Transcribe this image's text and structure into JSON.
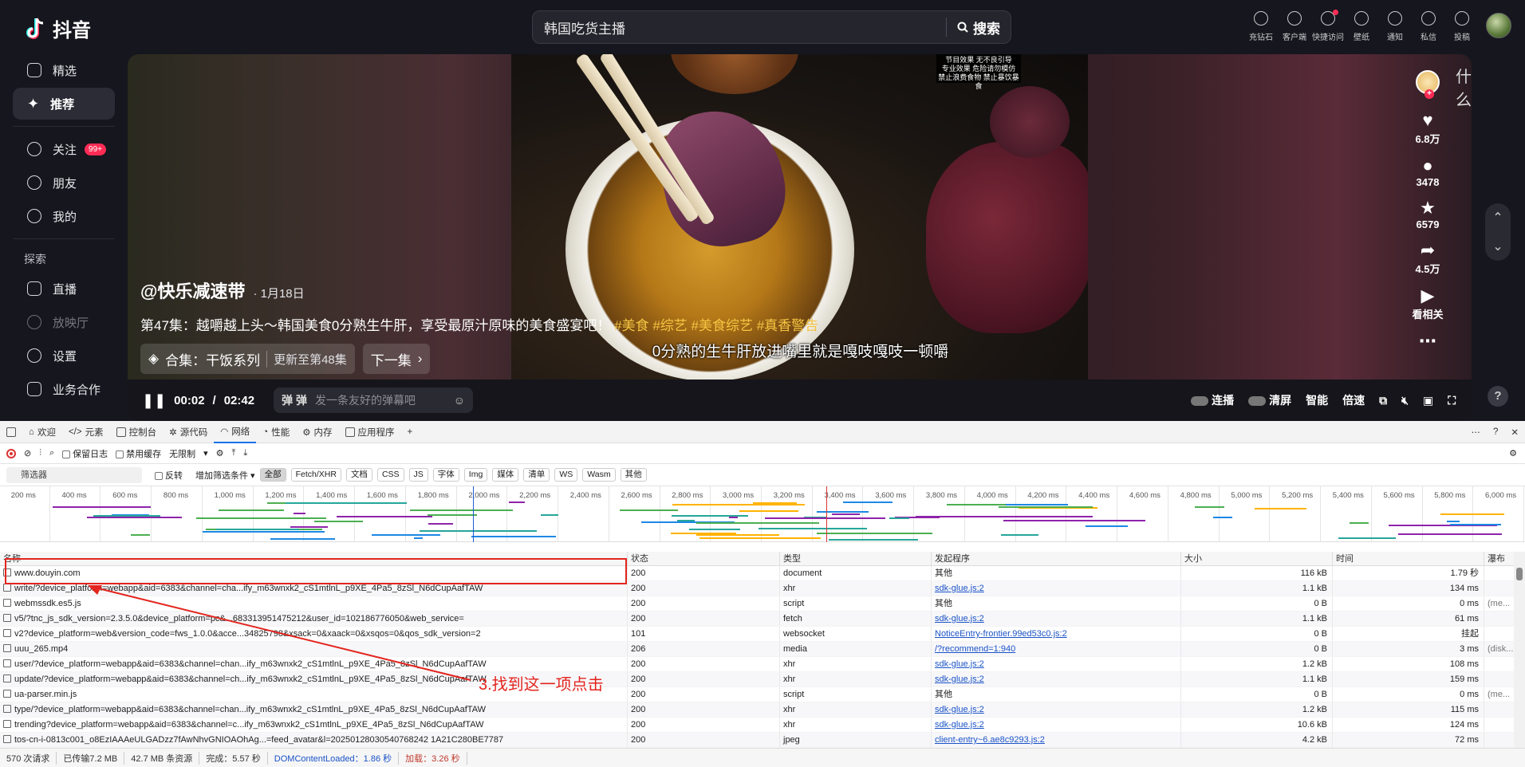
{
  "app": {
    "logo_text": "抖音",
    "search": {
      "query": "韩国吃货主播",
      "button": "搜索"
    },
    "top_icons": [
      {
        "icon": "diamond-icon",
        "label": "充钻石"
      },
      {
        "icon": "download-icon",
        "label": "客户端"
      },
      {
        "icon": "lightning-icon",
        "label": "快捷访问"
      },
      {
        "icon": "wallpaper-icon",
        "label": "壁纸"
      },
      {
        "icon": "bell-icon",
        "label": "通知"
      },
      {
        "icon": "message-icon",
        "label": "私信"
      },
      {
        "icon": "upload-icon",
        "label": "投稿"
      }
    ]
  },
  "sidebar": {
    "items": [
      {
        "icon": "tv-icon",
        "label": "精选"
      },
      {
        "icon": "sparkle-icon",
        "label": "推荐"
      },
      {
        "icon": "follow-icon",
        "label": "关注",
        "badge": "99+"
      },
      {
        "icon": "friends-icon",
        "label": "朋友"
      },
      {
        "icon": "user-icon",
        "label": "我的"
      }
    ],
    "section_title": "探索",
    "explore": [
      {
        "icon": "live-icon",
        "label": "直播"
      },
      {
        "icon": "cinema-icon",
        "label": "放映厅"
      }
    ],
    "bottom": [
      {
        "icon": "settings-icon",
        "label": "设置"
      },
      {
        "icon": "grid-icon",
        "label": "业务合作"
      }
    ]
  },
  "video": {
    "author": "@快乐减速带",
    "date": "· 1月18日",
    "desc": "第47集：越嚼越上头～韩国美食0分熟生牛肝，享受最原汁原味的美食盛宴吧！",
    "tags": [
      "#美食",
      "#综艺",
      "#美食综艺",
      "#真香警告"
    ],
    "collection": "合集：干饭系列",
    "collection_update": "更新至第48集",
    "next": "下一集",
    "subtitle": "0分熟的生牛肝放进嘴里就是嘎吱嘎吱一顿嚼",
    "notice": [
      "节目效果 无不良引导",
      "专业效果 危险请勿模仿",
      "禁止浪费食物 禁止暴饮暴食"
    ],
    "side_text": "什么",
    "likes": "6.8万",
    "comments": "3478",
    "favorites": "6579",
    "shares": "4.5万",
    "related": "看相关",
    "time_current": "00:02",
    "time_sep": "/",
    "time_total": "02:42",
    "danmu_placeholder": "发一条友好的弹幕吧",
    "controls": [
      "连播",
      "清屏",
      "智能",
      "倍速"
    ]
  },
  "devtools": {
    "tabs": [
      "欢迎",
      "元素",
      "控制台",
      "源代码",
      "网络",
      "性能",
      "内存",
      "应用程序"
    ],
    "selected_tab": "网络",
    "toolbar": {
      "preserve_log": "保留日志",
      "disable_cache": "禁用缓存",
      "throttle": "无限制"
    },
    "filter": {
      "placeholder": "筛选器",
      "invert": "反转",
      "more": "增加筛选条件"
    },
    "types": [
      "全部",
      "Fetch/XHR",
      "文档",
      "CSS",
      "JS",
      "字体",
      "Img",
      "媒体",
      "清单",
      "WS",
      "Wasm",
      "其他"
    ],
    "timeline_ticks": [
      "200 ms",
      "400 ms",
      "600 ms",
      "800 ms",
      "1,000 ms",
      "1,200 ms",
      "1,400 ms",
      "1,600 ms",
      "1,800 ms",
      "2,000 ms",
      "2,200 ms",
      "2,400 ms",
      "2,600 ms",
      "2,800 ms",
      "3,000 ms",
      "3,200 ms",
      "3,400 ms",
      "3,600 ms",
      "3,800 ms",
      "4,000 ms",
      "4,200 ms",
      "4,400 ms",
      "4,600 ms",
      "4,800 ms",
      "5,000 ms",
      "5,200 ms",
      "5,400 ms",
      "5,600 ms",
      "5,800 ms",
      "6,000 ms"
    ],
    "columns": [
      "名称",
      "状态",
      "类型",
      "发起程序",
      "大小",
      "时间",
      "瀑布"
    ],
    "rows": [
      {
        "name": "www.douyin.com",
        "status": "200",
        "type": "document",
        "initiator": "其他",
        "link": false,
        "size": "116 kB",
        "time": "1.79 秒",
        "extra": ""
      },
      {
        "name": "write/?device_platform=webapp&aid=6383&channel=cha...ify_m63wnxk2_cS1mtlnL_p9XE_4Pa5_8zSl_N6dCupAafTAW",
        "status": "200",
        "type": "xhr",
        "initiator": "sdk-glue.js:2",
        "link": true,
        "size": "1.1 kB",
        "time": "134 ms",
        "extra": ""
      },
      {
        "name": "webmssdk.es5.js",
        "status": "200",
        "type": "script",
        "initiator": "其他",
        "link": false,
        "size": "0 B",
        "time": "0 ms",
        "extra": "(me..."
      },
      {
        "name": "v5/?tnc_js_sdk_version=2.3.5.0&device_platform=pc&...683313951475212&user_id=102186776050&web_service=",
        "status": "200",
        "type": "fetch",
        "initiator": "sdk-glue.js:2",
        "link": true,
        "size": "1.1 kB",
        "time": "61 ms",
        "extra": ""
      },
      {
        "name": "v2?device_platform=web&version_code=fws_1.0.0&acce...34825798&xsack=0&xaack=0&xsqos=0&qos_sdk_version=2",
        "status": "101",
        "type": "websocket",
        "initiator": "NoticeEntry-frontier.99ed53c0.js:2",
        "link": true,
        "size": "0 B",
        "time": "挂起",
        "extra": ""
      },
      {
        "name": "uuu_265.mp4",
        "status": "206",
        "type": "media",
        "initiator": "/?recommend=1:940",
        "link": true,
        "size": "0 B",
        "time": "3 ms",
        "extra": "(disk..."
      },
      {
        "name": "user/?device_platform=webapp&aid=6383&channel=chan...ify_m63wnxk2_cS1mtlnL_p9XE_4Pa5_8zSl_N6dCupAafTAW",
        "status": "200",
        "type": "xhr",
        "initiator": "sdk-glue.js:2",
        "link": true,
        "size": "1.2 kB",
        "time": "108 ms",
        "extra": ""
      },
      {
        "name": "update/?device_platform=webapp&aid=6383&channel=ch...ify_m63wnxk2_cS1mtlnL_p9XE_4Pa5_8zSl_N6dCupAafTAW",
        "status": "200",
        "type": "xhr",
        "initiator": "sdk-glue.js:2",
        "link": true,
        "size": "1.1 kB",
        "time": "159 ms",
        "extra": ""
      },
      {
        "name": "ua-parser.min.js",
        "status": "200",
        "type": "script",
        "initiator": "其他",
        "link": false,
        "size": "0 B",
        "time": "0 ms",
        "extra": "(me..."
      },
      {
        "name": "type/?device_platform=webapp&aid=6383&channel=chan...ify_m63wnxk2_cS1mtlnL_p9XE_4Pa5_8zSl_N6dCupAafTAW",
        "status": "200",
        "type": "xhr",
        "initiator": "sdk-glue.js:2",
        "link": true,
        "size": "1.2 kB",
        "time": "115 ms",
        "extra": ""
      },
      {
        "name": "trending?device_platform=webapp&aid=6383&channel=c...ify_m63wnxk2_cS1mtlnL_p9XE_4Pa5_8zSl_N6dCupAafTAW",
        "status": "200",
        "type": "xhr",
        "initiator": "sdk-glue.js:2",
        "link": true,
        "size": "10.6 kB",
        "time": "124 ms",
        "extra": ""
      },
      {
        "name": "tos-cn-i-0813c001_o8EzIAAAeULGADzz7fAwNhvGNIOAOhAg...=feed_avatar&l=20250128030540768242 1A21C280BE7787",
        "status": "200",
        "type": "jpeg",
        "initiator": "client-entry~6.ae8c9293.js:2",
        "link": true,
        "size": "4.2 kB",
        "time": "72 ms",
        "extra": ""
      }
    ],
    "status_bar": [
      "570 次请求",
      "已传输7.2 MB",
      "42.7 MB 条资源",
      "完成：5.57 秒",
      "DOMContentLoaded：1.86 秒",
      "加载：3.26 秒"
    ],
    "annotation": "3.找到这一项点击"
  },
  "colors": {
    "accent": "#fe2c55",
    "tag": "#f5c542",
    "annotation": "#e3251e",
    "link": "#1a53c6"
  }
}
